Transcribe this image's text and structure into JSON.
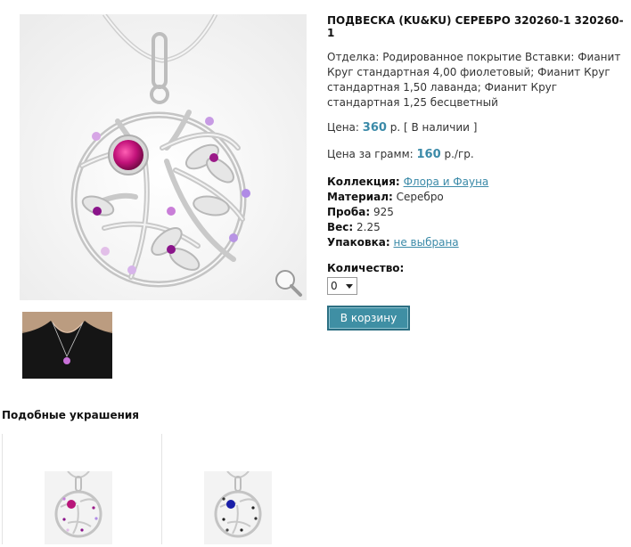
{
  "product": {
    "title": "ПОДВЕСКА (KU&KU) СЕРЕБРО 320260-1 320260-1",
    "finish": "Отделка: Родированное покрытие Вставки: Фианит Круг стандартная 4,00 фиолетовый; Фианит Круг стандартная 1,50 лаванда; Фианит Круг стандартная 1,25 бесцветный",
    "price_label": "Цена:",
    "price_value": "360",
    "price_unit": "р.",
    "availability": "[ В наличии ]",
    "gram_label": "Цена за грамм:",
    "gram_value": "160",
    "gram_unit": "р./гр.",
    "collection_label": "Коллекция:",
    "collection_value": "Флора и Фауна",
    "material_label": "Материал:",
    "material_value": "Серебро",
    "probe_label": "Проба:",
    "probe_value": "925",
    "weight_label": "Вес:",
    "weight_value": "2.25",
    "pack_label": "Упаковка:",
    "pack_value": "не выбрана",
    "qty_label": "Количество:",
    "qty_value": "0",
    "cart_button": "В корзину"
  },
  "similar": {
    "heading": "Подобные украшения",
    "items": [
      {
        "stone": "purple"
      },
      {
        "stone": "blue"
      }
    ]
  },
  "colors": {
    "accent": "#3b8aa8",
    "button": "#3f8fa4"
  }
}
